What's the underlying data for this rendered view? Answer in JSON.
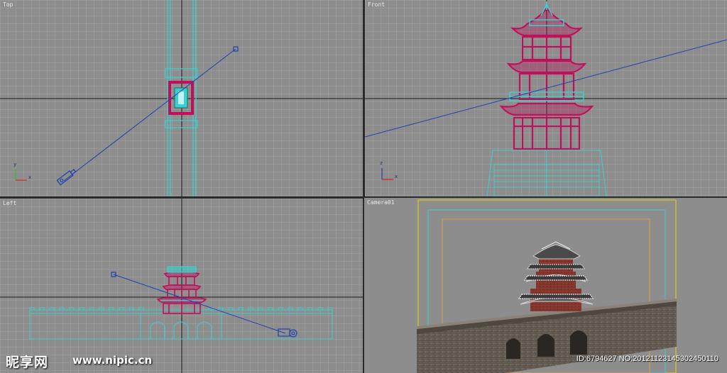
{
  "viewports": {
    "top": {
      "label": "Top"
    },
    "front": {
      "label": "Front"
    },
    "left": {
      "label": "Left"
    },
    "camera": {
      "label": "Camera01"
    }
  },
  "axis_labels": {
    "x": "x",
    "y": "y",
    "z": "z"
  },
  "colors": {
    "viewport_bg": "#8d8d8d",
    "grid": "#a0a0a0",
    "axis_line": "#1a1a1a",
    "building_wire": "#c0105a",
    "guide_wire": "#3ad0d0",
    "camera_line": "#2040b0",
    "active_border": "#e8d800"
  },
  "watermark": {
    "logo": "昵享网",
    "url": "www.nipic.cn",
    "id": "ID:6794627 NO:20121123145302450110"
  }
}
